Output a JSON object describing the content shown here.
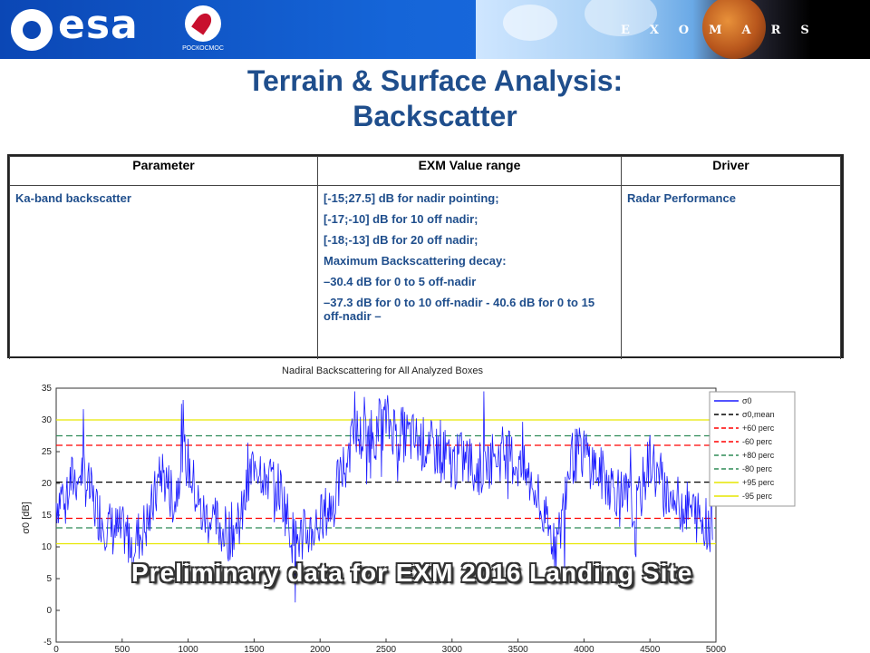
{
  "header": {
    "esa_logo_text": "esa",
    "roscosmos_text": "РОСКОСМОС",
    "exomars_text": "EXOMARS"
  },
  "title": {
    "line1": "Terrain & Surface Analysis:",
    "line2": "Backscatter"
  },
  "table": {
    "headers": [
      "Parameter",
      "EXM Value range",
      "Driver"
    ],
    "row": {
      "parameter": "Ka-band backscatter",
      "values": [
        "[-15;27.5] dB for nadir pointing;",
        "[-17;-10] dB for 10 off nadir;",
        "[-18;-13] dB for 20 off nadir;",
        "Maximum Backscattering decay:",
        " –30.4 dB for 0 to 5 off-nadir",
        "–37.3 dB for 0 to 10 off-nadir - 40.6 dB for 0 to 15 off-nadir –"
      ],
      "driver": "Radar Performance"
    }
  },
  "overlay_text": "Preliminary data for EXM 2016 Landing Site",
  "chart_data": {
    "type": "line",
    "title": "Nadiral Backscattering for All Analyzed Boxes",
    "xlabel": "",
    "ylabel": "σ0 [dB]",
    "xlim": [
      0,
      5000
    ],
    "ylim": [
      -5,
      35
    ],
    "xticks": [
      0,
      500,
      1000,
      1500,
      2000,
      2500,
      3000,
      3500,
      4000,
      4500,
      5000
    ],
    "yticks": [
      -5,
      0,
      5,
      10,
      15,
      20,
      25,
      30,
      35
    ],
    "legend_position": "right",
    "series": [
      {
        "name": "σ0",
        "color": "#1a1aff",
        "style": "solid",
        "note": "noisy backscatter signal"
      },
      {
        "name": "σ0,mean",
        "color": "#000000",
        "style": "dashed",
        "value": 20.2
      },
      {
        "name": "+60 perc",
        "color": "#ff0000",
        "style": "dashed",
        "value": 26
      },
      {
        "name": "-60 perc",
        "color": "#ff0000",
        "style": "dashed",
        "value": 14.5
      },
      {
        "name": "+80 perc",
        "color": "#2e8b57",
        "style": "dashed",
        "value": 27.5
      },
      {
        "name": "-80 perc",
        "color": "#2e8b57",
        "style": "dashed",
        "value": 13
      },
      {
        "name": "+95 perc",
        "color": "#e6e600",
        "style": "solid",
        "value": 30
      },
      {
        "name": "-95 perc",
        "color": "#e6e600",
        "style": "solid",
        "value": 10.5
      }
    ],
    "signal_profile": [
      [
        0,
        17
      ],
      [
        100,
        20
      ],
      [
        200,
        22
      ],
      [
        300,
        16
      ],
      [
        400,
        13
      ],
      [
        500,
        12
      ],
      [
        600,
        11
      ],
      [
        700,
        14
      ],
      [
        800,
        22
      ],
      [
        900,
        17
      ],
      [
        950,
        25
      ],
      [
        1000,
        23
      ],
      [
        1100,
        15
      ],
      [
        1200,
        14
      ],
      [
        1300,
        12
      ],
      [
        1400,
        14
      ],
      [
        1500,
        24
      ],
      [
        1600,
        21
      ],
      [
        1700,
        19
      ],
      [
        1800,
        11
      ],
      [
        1900,
        12
      ],
      [
        2000,
        14
      ],
      [
        2100,
        17
      ],
      [
        2200,
        24
      ],
      [
        2250,
        30
      ],
      [
        2300,
        27
      ],
      [
        2400,
        28
      ],
      [
        2500,
        30
      ],
      [
        2600,
        28
      ],
      [
        2700,
        27
      ],
      [
        2800,
        26
      ],
      [
        2900,
        25
      ],
      [
        3000,
        23
      ],
      [
        3100,
        24
      ],
      [
        3200,
        22
      ],
      [
        3300,
        24
      ],
      [
        3400,
        25
      ],
      [
        3500,
        23
      ],
      [
        3600,
        20
      ],
      [
        3700,
        14
      ],
      [
        3800,
        10
      ],
      [
        3900,
        24
      ],
      [
        4000,
        25
      ],
      [
        4100,
        22
      ],
      [
        4200,
        20
      ],
      [
        4300,
        18
      ],
      [
        4400,
        16
      ],
      [
        4500,
        24
      ],
      [
        4600,
        19
      ],
      [
        4700,
        17
      ],
      [
        4800,
        16
      ],
      [
        4900,
        14
      ],
      [
        4980,
        13
      ]
    ]
  }
}
